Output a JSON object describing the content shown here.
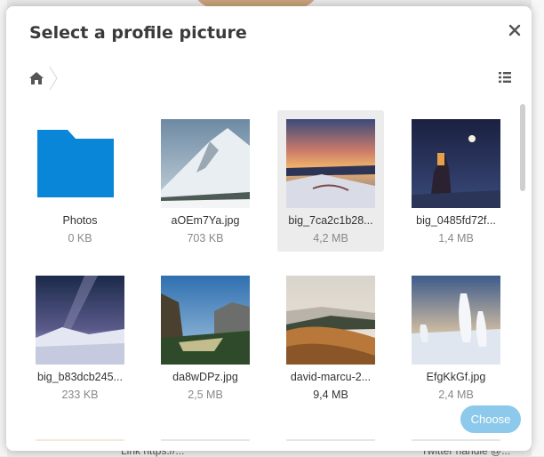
{
  "background": {
    "footer_left": "Link https://...",
    "footer_right": "Twitter handle @..."
  },
  "dialog": {
    "title": "Select a profile picture",
    "close_icon": "close-icon",
    "home_icon": "home-icon",
    "view_toggle_icon": "list-view-icon",
    "choose_label": "Choose"
  },
  "files": [
    {
      "name": "Photos",
      "size": "0 KB",
      "type": "folder"
    },
    {
      "name": "aOEm7Ya.jpg",
      "size": "703 KB",
      "type": "image"
    },
    {
      "name": "big_7ca2c1b28...",
      "size": "4,2 MB",
      "type": "image",
      "selected": true
    },
    {
      "name": "big_0485fd72f...",
      "size": "1,4 MB",
      "type": "image"
    },
    {
      "name": "big_b83dcb245...",
      "size": "233 KB",
      "type": "image"
    },
    {
      "name": "da8wDPz.jpg",
      "size": "2,5 MB",
      "type": "image"
    },
    {
      "name": "david-marcu-2...",
      "size": "9,4 MB",
      "type": "image"
    },
    {
      "name": "EfgKkGf.jpg",
      "size": "2,4 MB",
      "type": "image"
    }
  ],
  "colors": {
    "accent": "#8cc9ea",
    "folder": "#0a86d8",
    "selected_bg": "#ececec"
  }
}
